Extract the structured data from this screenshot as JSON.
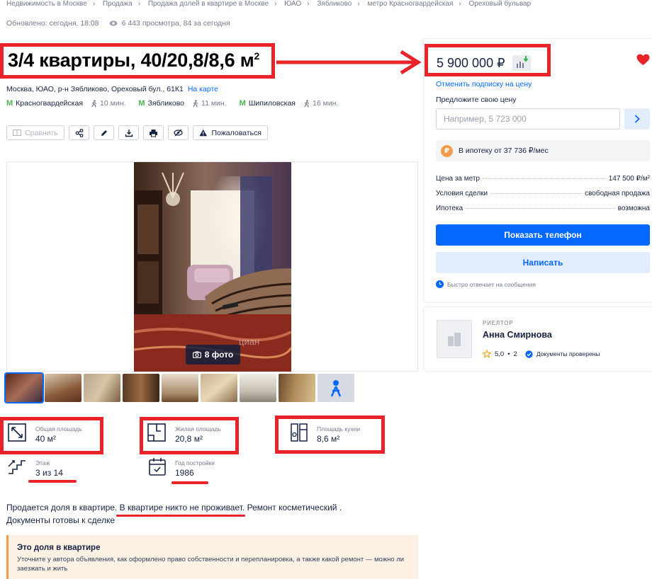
{
  "breadcrumbs": [
    "Недвижимость в Москве",
    "Продажа",
    "Продажа долей в квартире в Москве",
    "ЮАО",
    "Зябликово",
    "метро Красногвардейская",
    "Ореховый бульвар"
  ],
  "meta": {
    "updated": "Обновлено: сегодня, 18:08",
    "views": "6 443 просмотра, 84 за сегодня"
  },
  "title": {
    "text": "3/4 квартиры, 40/20,8/8,6 м",
    "sup": "2"
  },
  "address": {
    "text": "Москва, ЮАО, р-н Зябликово, Ореховый бул., 61К1",
    "map_link": "На карте"
  },
  "metro": [
    {
      "name": "Красногвардейская",
      "walk": "10 мин."
    },
    {
      "name": "Зябликово",
      "walk": "11 мин."
    },
    {
      "name": "Шипиловская",
      "walk": "16 мин."
    }
  ],
  "toolbar": {
    "compare": "Сравнить",
    "complain": "Пожаловаться"
  },
  "gallery": {
    "photo_count": "8 фото",
    "watermark": "циан"
  },
  "features": {
    "total_area": {
      "label": "Общая площадь",
      "value": "40 м²"
    },
    "living_area": {
      "label": "Жилая площадь",
      "value": "20,8 м²"
    },
    "kitchen_area": {
      "label": "Площадь кухни",
      "value": "8,6 м²"
    },
    "floor": {
      "label": "Этаж",
      "value": "3 из 14"
    },
    "year": {
      "label": "Год постройки",
      "value": "1986"
    }
  },
  "description": {
    "part1": "Продается доля в квартире. ",
    "part2": "В квартире никто не проживает",
    "part3": ". Ремонт косметический .",
    "line2": "Документы готовы к сделке"
  },
  "notice": {
    "title": "Это доля в квартире",
    "text": "Уточните у автора объявления, как оформлено право собственности и перепланировка, а также какой ремонт — можно ли заезжать и жить"
  },
  "price": {
    "value": "5 900 000 ₽",
    "unsubscribe": "Отменить подписку на цену",
    "offer_label": "Предложите свою цену",
    "offer_placeholder": "Например, 5 723 000",
    "mortgage": "В ипотеку от 37 736 ₽/мес",
    "details": [
      {
        "key": "Цена за метр",
        "value": "147 500 ₽/м²"
      },
      {
        "key": "Условия сделки",
        "value": "свободная продажа"
      },
      {
        "key": "Ипотека",
        "value": "возможна"
      }
    ],
    "show_phone": "Показать телефон",
    "write": "Написать",
    "fast_reply": "Быстро отвечает на сообщения"
  },
  "agent": {
    "role": "РИЕЛТОР",
    "name": "Анна Смирнова",
    "rating": "5,0",
    "reviews": "2",
    "verified": "Документы проверены"
  },
  "colors": {
    "accent": "#0468ff",
    "highlight": "#e8232a",
    "text": "#152242",
    "metro": "#4caf50"
  }
}
